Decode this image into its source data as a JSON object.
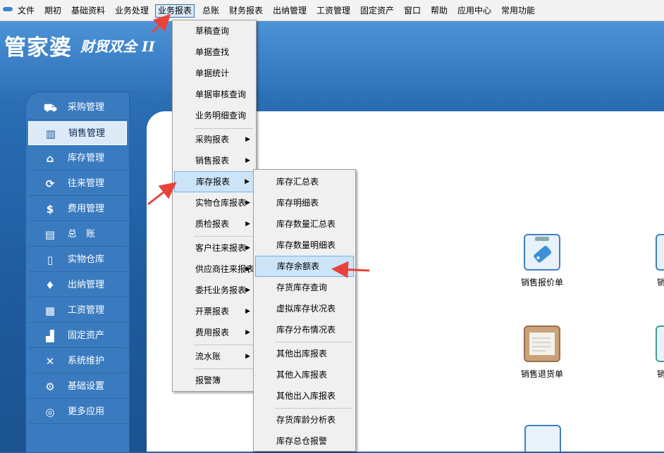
{
  "menubar": {
    "items": [
      "文件",
      "期初",
      "基础资料",
      "业务处理",
      "业务报表",
      "总账",
      "财务报表",
      "出纳管理",
      "工资管理",
      "固定资产",
      "窗口",
      "帮助",
      "应用中心",
      "常用功能"
    ],
    "active": "业务报表"
  },
  "brand": {
    "main": "管家婆",
    "sub": "财贸双全 II"
  },
  "sidebar": {
    "items": [
      {
        "label": "采购管理",
        "icon": "cart-icon"
      },
      {
        "label": "销售管理",
        "icon": "chart-icon",
        "active": true
      },
      {
        "label": "库存管理",
        "icon": "home-icon"
      },
      {
        "label": "往来管理",
        "icon": "refresh-icon"
      },
      {
        "label": "费用管理",
        "icon": "dollar-icon"
      },
      {
        "label": "总　账",
        "icon": "ledger-icon"
      },
      {
        "label": "实物仓库",
        "icon": "warehouse-icon"
      },
      {
        "label": "出纳管理",
        "icon": "money-bag-icon"
      },
      {
        "label": "工资管理",
        "icon": "grid-icon"
      },
      {
        "label": "固定资产",
        "icon": "asset-icon"
      },
      {
        "label": "系统维护",
        "icon": "tools-icon"
      },
      {
        "label": "基础设置",
        "icon": "gear-icon"
      },
      {
        "label": "更多应用",
        "icon": "target-icon"
      }
    ]
  },
  "report_menu": {
    "items": [
      {
        "label": "草稿查询"
      },
      {
        "label": "单据查找"
      },
      {
        "label": "单据统计"
      },
      {
        "label": "单据审核查询"
      },
      {
        "label": "业务明细查询"
      },
      {
        "label": "采购报表",
        "submenu": true
      },
      {
        "label": "销售报表",
        "submenu": true
      },
      {
        "label": "库存报表",
        "submenu": true,
        "highlighted": true
      },
      {
        "label": "实物仓库报表",
        "submenu": true
      },
      {
        "label": "质检报表",
        "submenu": true
      },
      {
        "label": "客户往来报表",
        "submenu": true
      },
      {
        "label": "供应商往来报表",
        "submenu": true
      },
      {
        "label": "委托业务报表",
        "submenu": true
      },
      {
        "label": "开票报表",
        "submenu": true
      },
      {
        "label": "费用报表",
        "submenu": true
      },
      {
        "label": "流水账",
        "submenu": true
      },
      {
        "label": "报警簿"
      }
    ]
  },
  "inventory_submenu": {
    "items": [
      {
        "label": "库存汇总表"
      },
      {
        "label": "库存明细表"
      },
      {
        "label": "库存数量汇总表"
      },
      {
        "label": "库存数量明细表"
      },
      {
        "label": "库存余额表",
        "highlighted": true
      },
      {
        "label": "存货库存查询"
      },
      {
        "label": "虚拟库存状况表"
      },
      {
        "label": "库存分布情况表"
      },
      {
        "label": "其他出库报表"
      },
      {
        "label": "其他入库报表"
      },
      {
        "label": "其他出入库报表"
      },
      {
        "label": "存货库龄分析表"
      },
      {
        "label": "库存总仓报警"
      }
    ]
  },
  "tiles": [
    {
      "label": "销售报价单",
      "icon": "quote-clipboard-icon"
    },
    {
      "label": "销售退货单",
      "icon": "return-notebook-icon"
    },
    {
      "label": "销",
      "icon": "document-icon"
    },
    {
      "label": "销",
      "icon": "document-icon"
    }
  ],
  "colors": {
    "accent": "#3a7bc0",
    "highlight": "#cce4f7",
    "annotation": "#e8423b"
  }
}
